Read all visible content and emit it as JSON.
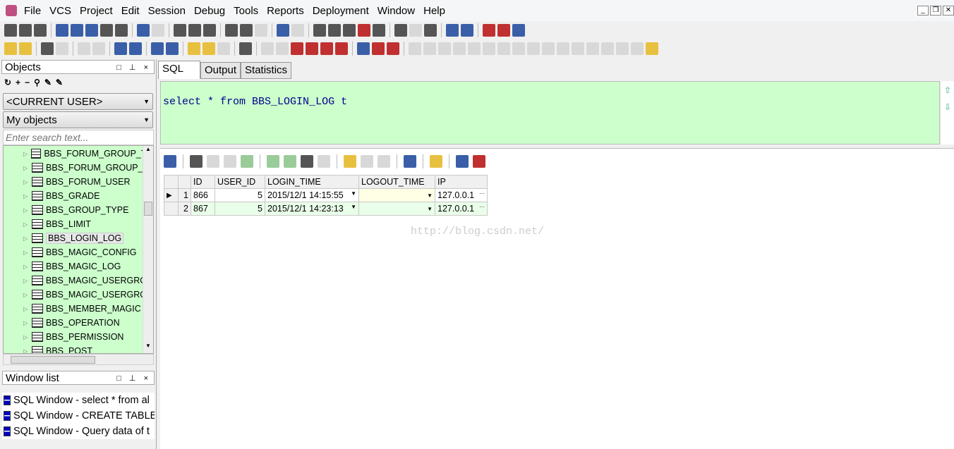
{
  "menu": [
    "File",
    "VCS",
    "Project",
    "Edit",
    "Session",
    "Debug",
    "Tools",
    "Reports",
    "Deployment",
    "Window",
    "Help"
  ],
  "objects_panel": {
    "title": "Objects",
    "user_select": "<CURRENT USER>",
    "filter_select": "My objects",
    "search_placeholder": "Enter search text...",
    "tree": [
      "BBS_FORUM_GROUP_TO",
      "BBS_FORUM_GROUP_VI",
      "BBS_FORUM_USER",
      "BBS_GRADE",
      "BBS_GROUP_TYPE",
      "BBS_LIMIT",
      "BBS_LOGIN_LOG",
      "BBS_MAGIC_CONFIG",
      "BBS_MAGIC_LOG",
      "BBS_MAGIC_USERGROU",
      "BBS_MAGIC_USERGROU",
      "BBS_MEMBER_MAGIC",
      "BBS_OPERATION",
      "BBS_PERMISSION",
      "BBS_POST"
    ],
    "selected": "BBS_LOGIN_LOG"
  },
  "window_list": {
    "title": "Window list",
    "items": [
      "SQL Window - select * from al",
      "SQL Window - CREATE TABLE",
      "SQL Window - Query data of t"
    ]
  },
  "tabs": [
    "SQL",
    "Output",
    "Statistics"
  ],
  "editor": {
    "kw1": "select",
    "sym": " * ",
    "kw2": "from",
    "rest": " BBS_LOGIN_LOG t"
  },
  "grid": {
    "columns": [
      "ID",
      "USER_ID",
      "LOGIN_TIME",
      "LOGOUT_TIME",
      "IP"
    ],
    "rows": [
      {
        "n": "1",
        "id": "866",
        "user_id": "5",
        "login": "2015/12/1 14:15:55",
        "logout": "",
        "ip": "127.0.0.1"
      },
      {
        "n": "2",
        "id": "867",
        "user_id": "5",
        "login": "2015/12/1 14:23:13",
        "logout": "",
        "ip": "127.0.0.1"
      }
    ]
  },
  "watermark": "http://blog.csdn.net/"
}
